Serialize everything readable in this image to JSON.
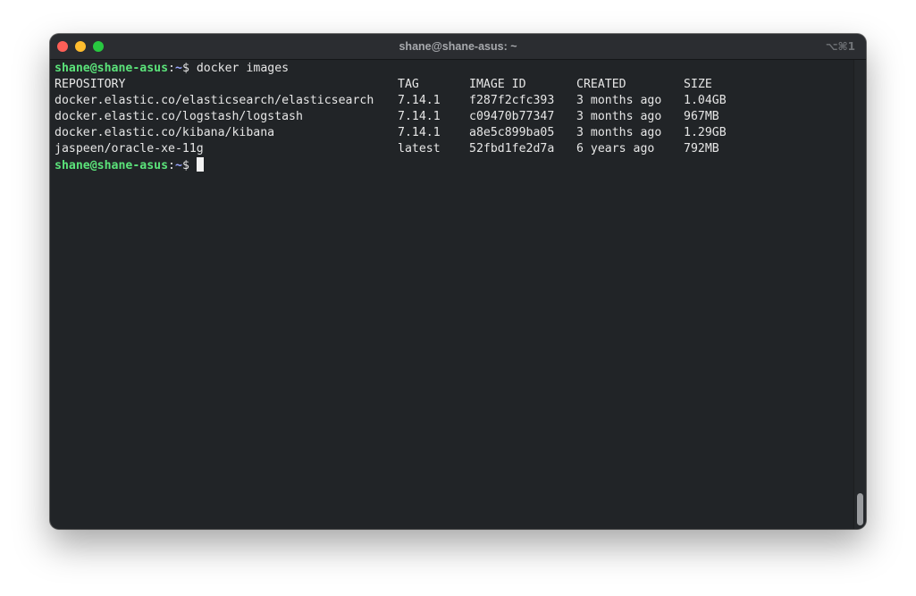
{
  "window": {
    "title": "shane@shane-asus: ~",
    "shortcut": "⌥⌘1"
  },
  "terminal": {
    "prompt_user": "shane@shane-asus",
    "prompt_colon": ":",
    "prompt_path": "~",
    "prompt_symbol": "$",
    "command": "docker images",
    "columns": [
      "REPOSITORY",
      "TAG",
      "IMAGE ID",
      "CREATED",
      "SIZE"
    ],
    "rows": [
      [
        "docker.elastic.co/elasticsearch/elasticsearch",
        "7.14.1",
        "f287f2cfc393",
        "3 months ago",
        "1.04GB"
      ],
      [
        "docker.elastic.co/logstash/logstash",
        "7.14.1",
        "c09470b77347",
        "3 months ago",
        "967MB"
      ],
      [
        "docker.elastic.co/kibana/kibana",
        "7.14.1",
        "a8e5c899ba05",
        "3 months ago",
        "1.29GB"
      ],
      [
        "jaspeen/oracle-xe-11g",
        "latest",
        "52fbd1fe2d7a",
        "6 years ago",
        "792MB"
      ]
    ]
  },
  "colors": {
    "background": "#212427",
    "prompt_user": "#5be37a",
    "prompt_path": "#9aa7ff",
    "text": "#e6e6e6"
  }
}
